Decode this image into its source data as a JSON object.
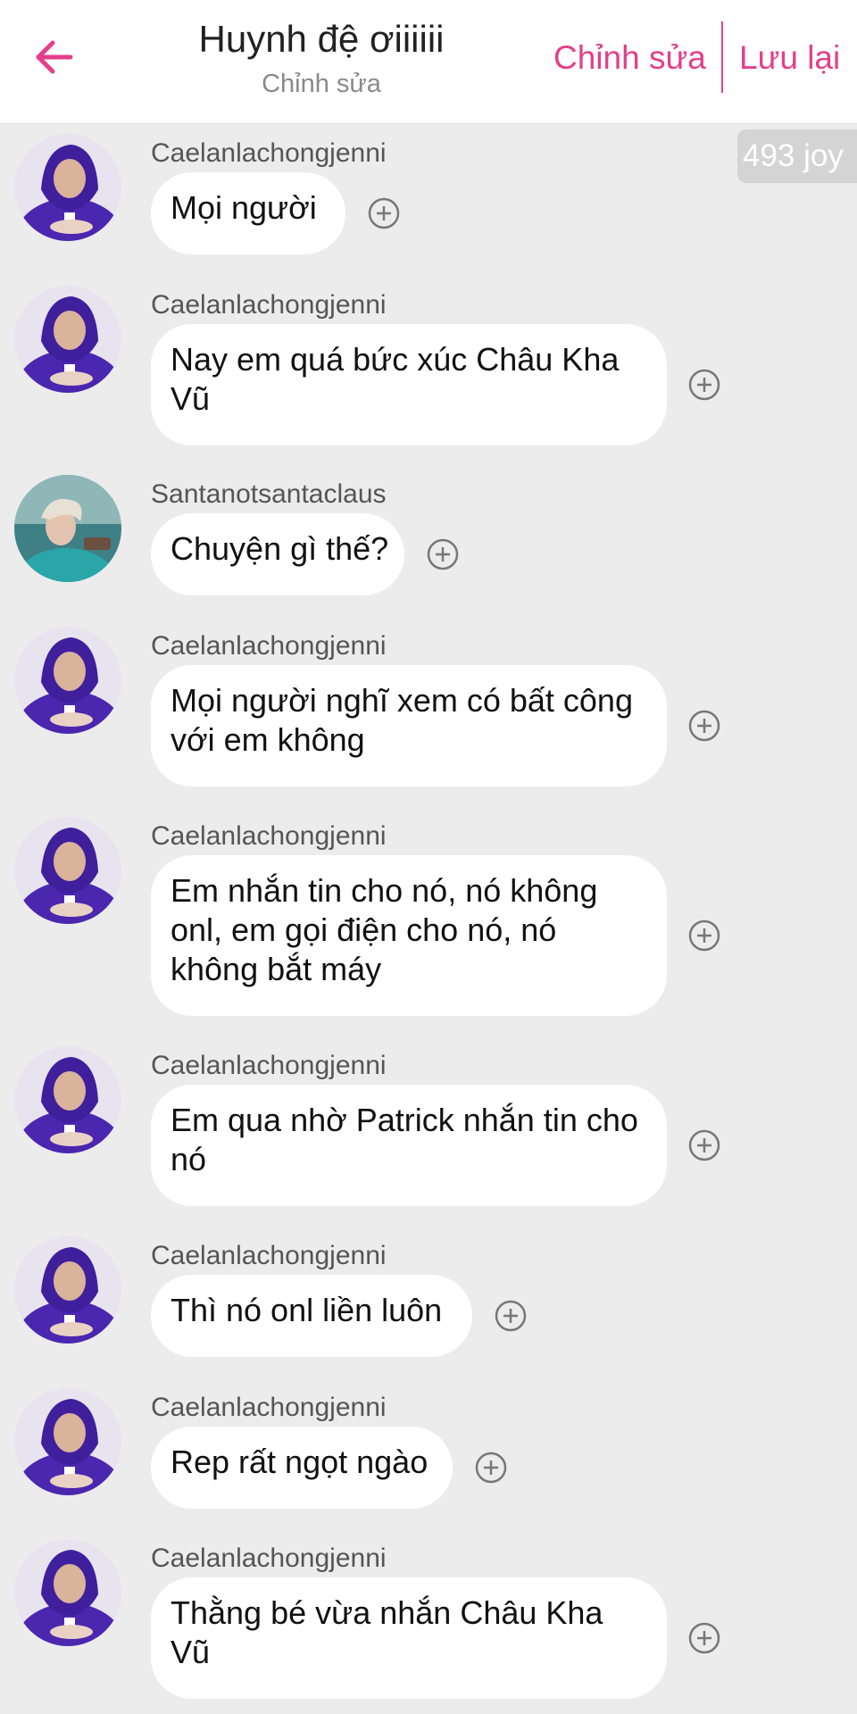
{
  "header": {
    "title": "Huynh đệ ơiiiiii",
    "subtitle": "Chỉnh sửa",
    "edit_label": "Chỉnh sửa",
    "save_label": "Lưu lại",
    "back_icon": "arrow-left-icon"
  },
  "joy_badge": "493 joy",
  "colors": {
    "accent": "#e33f8b",
    "background": "#ececec",
    "bubble": "#ffffff"
  },
  "messages": [
    {
      "username": "Caelanlachongjenni",
      "text": "Mọi người",
      "avatar": "purple-hoodie-avatar"
    },
    {
      "username": "Caelanlachongjenni",
      "text": "Nay em quá bức xúc Châu Kha Vũ",
      "avatar": "purple-hoodie-avatar"
    },
    {
      "username": "Santanotsantaclaus",
      "text": "Chuyện gì thế?",
      "avatar": "teal-sweater-avatar"
    },
    {
      "username": "Caelanlachongjenni",
      "text": "Mọi người nghĩ xem có bất công với em không",
      "avatar": "purple-hoodie-avatar"
    },
    {
      "username": "Caelanlachongjenni",
      "text": "Em nhắn tin cho nó, nó không onl, em gọi điện cho nó, nó không bắt máy",
      "avatar": "purple-hoodie-avatar"
    },
    {
      "username": "Caelanlachongjenni",
      "text": "Em qua nhờ Patrick nhắn tin cho nó",
      "avatar": "purple-hoodie-avatar"
    },
    {
      "username": "Caelanlachongjenni",
      "text": "Thì nó onl liền luôn",
      "avatar": "purple-hoodie-avatar"
    },
    {
      "username": "Caelanlachongjenni",
      "text": "Rep rất ngọt ngào",
      "avatar": "purple-hoodie-avatar"
    },
    {
      "username": "Caelanlachongjenni",
      "text": "Thằng bé vừa nhắn Châu Kha Vũ",
      "avatar": "purple-hoodie-avatar"
    }
  ]
}
